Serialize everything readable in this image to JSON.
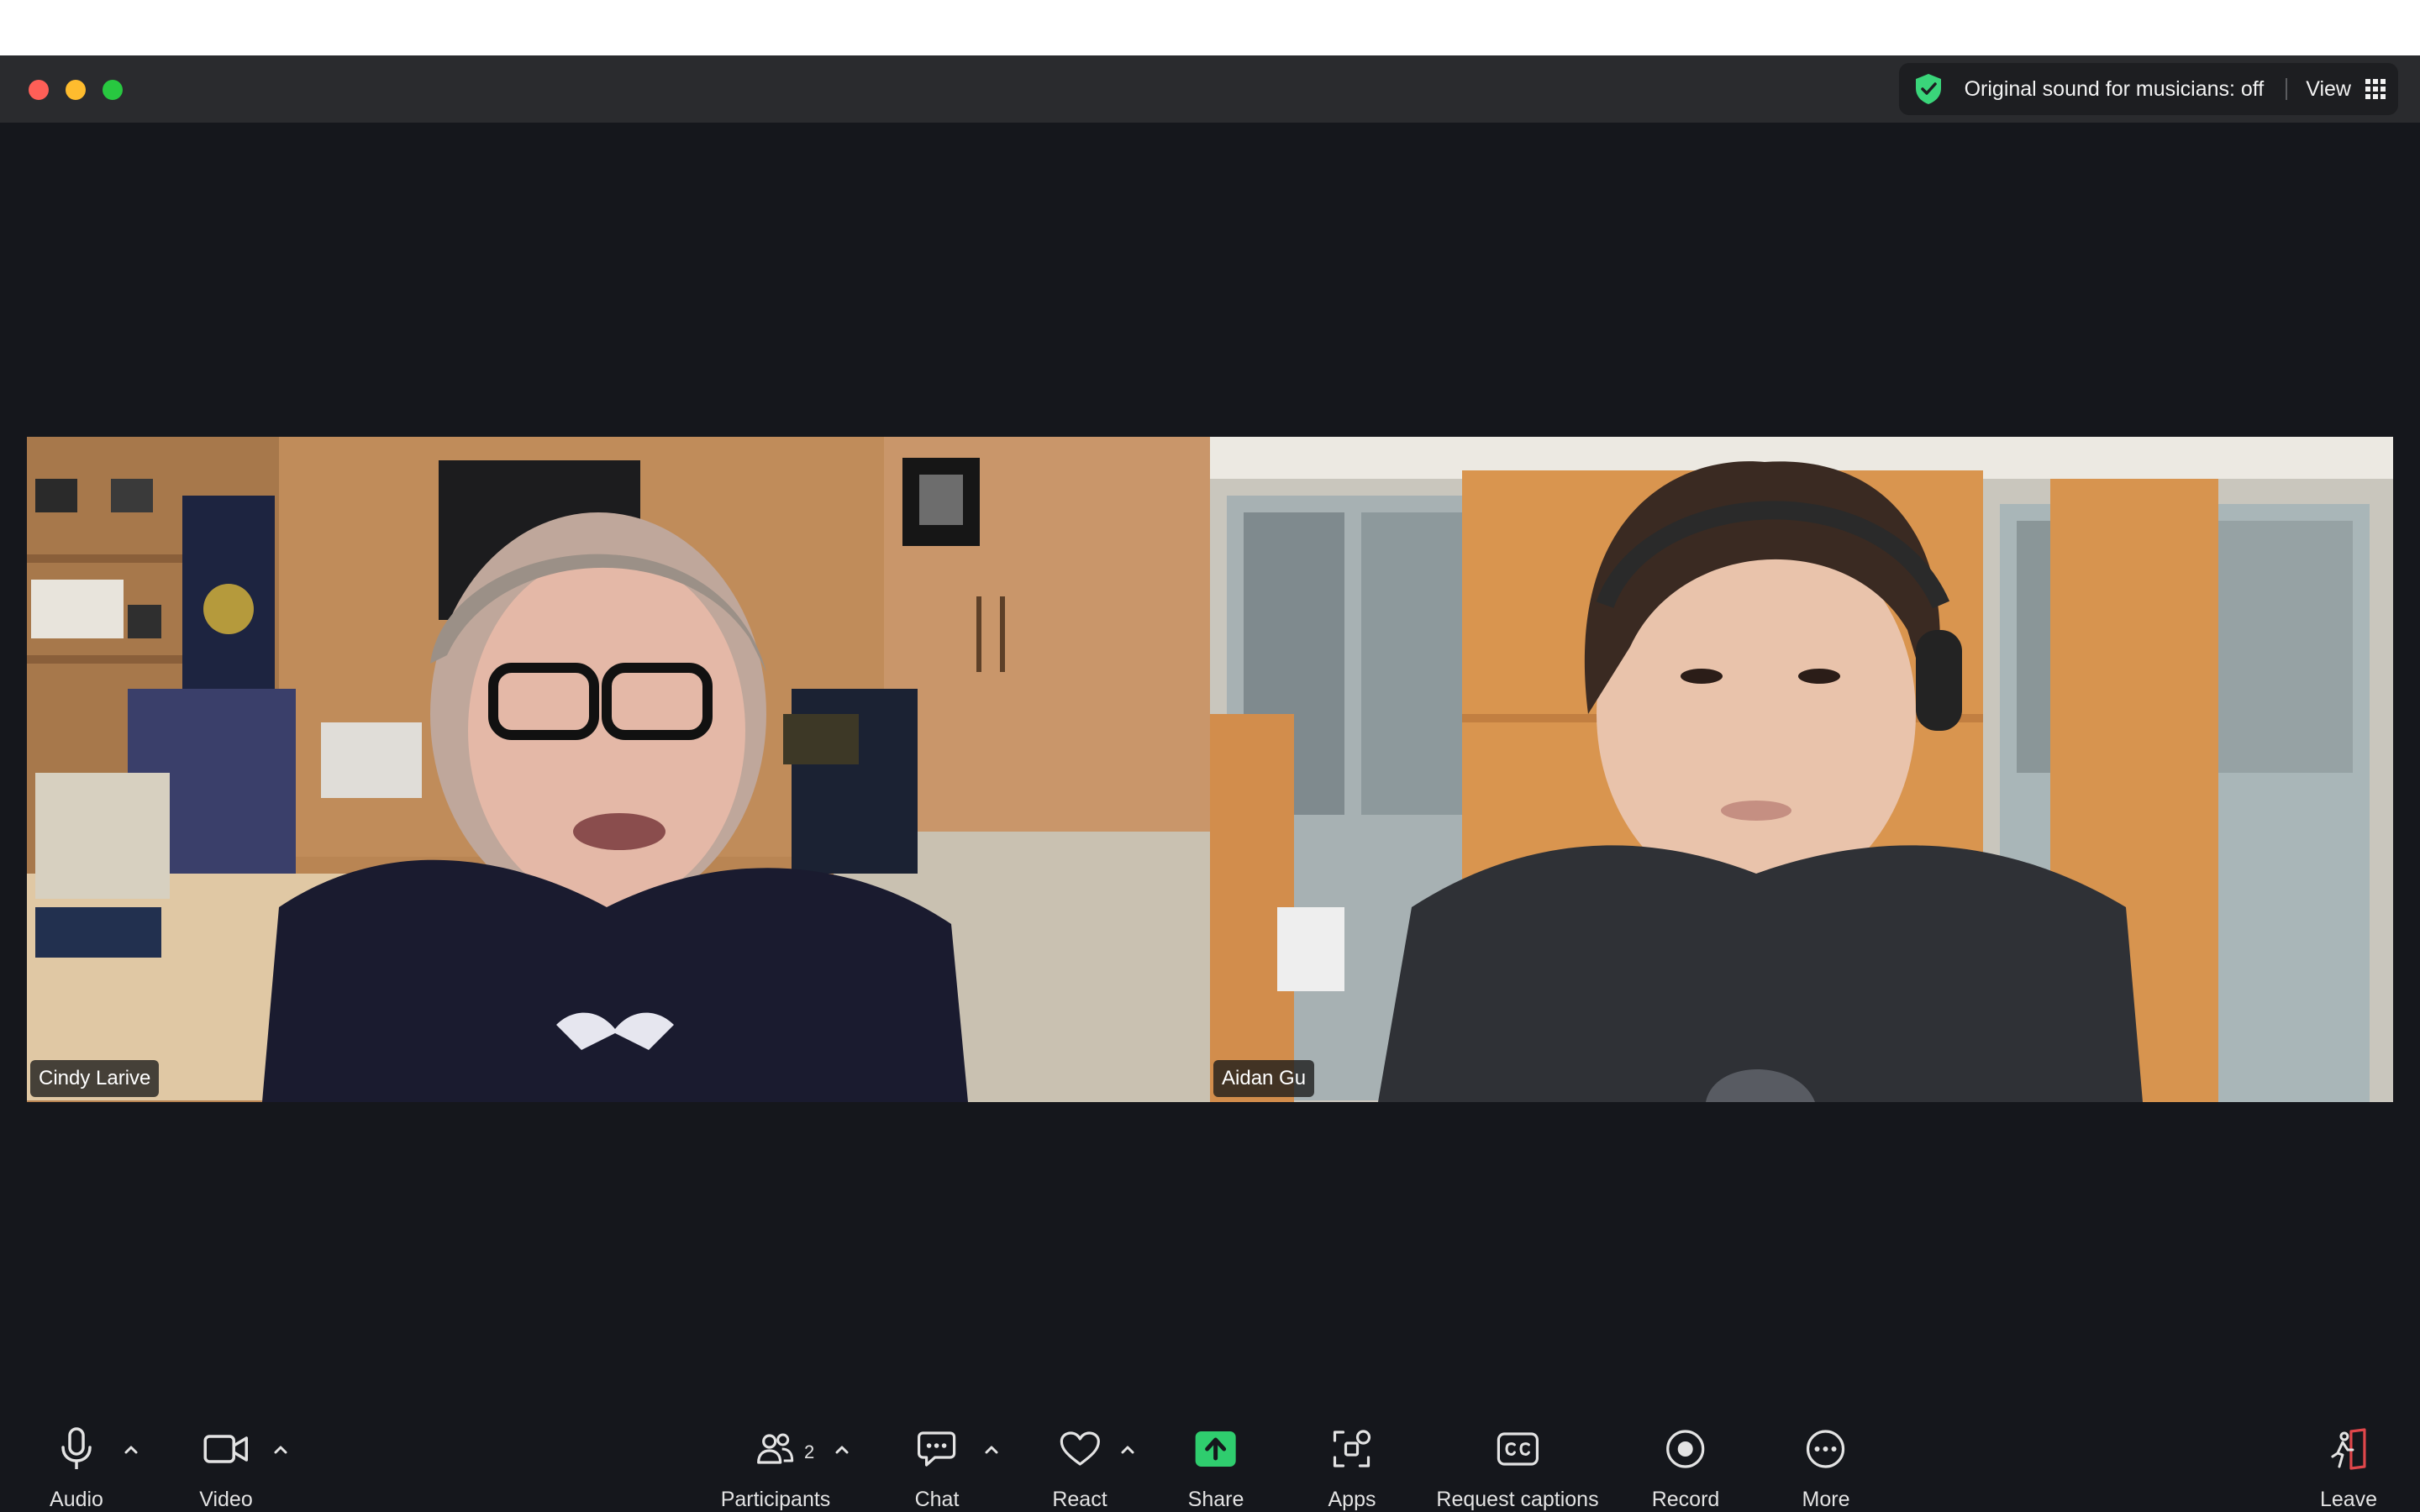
{
  "window": {
    "top_right": {
      "sound_label": "Original sound for musicians: off",
      "view_label": "View"
    }
  },
  "participants": [
    {
      "name": "Cindy Larive"
    },
    {
      "name": "Aidan Gu"
    }
  ],
  "toolbar": {
    "audio": "Audio",
    "video": "Video",
    "participants": "Participants",
    "participants_count": "2",
    "chat": "Chat",
    "react": "React",
    "share": "Share",
    "apps": "Apps",
    "captions": "Request captions",
    "record": "Record",
    "more": "More",
    "leave": "Leave"
  },
  "colors": {
    "background": "#15171c",
    "titlebar": "#2a2b2e",
    "share_green": "#2fcd6e",
    "shield_green": "#3ad57a",
    "leave_red": "#e0474b"
  },
  "icons": [
    "shield-check-icon",
    "grid-icon",
    "microphone-icon",
    "video-camera-icon",
    "participants-icon",
    "chat-icon",
    "heart-icon",
    "share-arrow-icon",
    "apps-icon",
    "cc-icon",
    "record-icon",
    "more-icon",
    "leave-icon",
    "chevron-up-icon"
  ]
}
